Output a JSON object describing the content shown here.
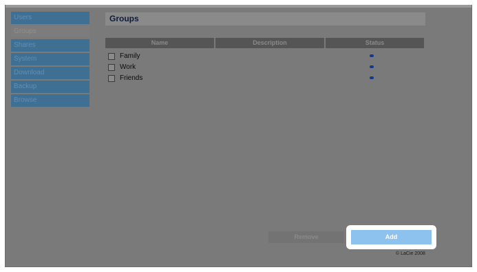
{
  "sidebar": {
    "items": [
      {
        "label": "Users"
      },
      {
        "label": "Groups",
        "active": true
      },
      {
        "label": "Shares"
      },
      {
        "label": "System"
      },
      {
        "label": "Download"
      },
      {
        "label": "Backup"
      },
      {
        "label": "Browse"
      }
    ]
  },
  "main": {
    "title": "Groups",
    "table": {
      "headers": [
        "Name",
        "Description",
        "Status"
      ],
      "rows": [
        {
          "name": "Family",
          "description": "",
          "status": "active"
        },
        {
          "name": "Work",
          "description": "",
          "status": "active"
        },
        {
          "name": "Friends",
          "description": "",
          "status": "active"
        }
      ]
    },
    "buttons": {
      "remove_label": "Remove",
      "add_label": "Add"
    },
    "footer": "© LaCie 2008"
  },
  "colors": {
    "accent": "#8ec2ee",
    "status_dot": "#123a8c",
    "sidebar_item": "#406f94"
  }
}
